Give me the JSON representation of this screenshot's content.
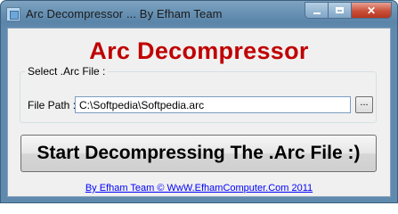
{
  "window": {
    "title": "Arc Decompressor ... By Efham Team",
    "controls": {
      "minimize": "minimize",
      "maximize": "maximize",
      "close": "✕"
    }
  },
  "main": {
    "heading": "Arc Decompressor",
    "group": {
      "label": "Select .Arc File :",
      "file_path_label": "File Path :",
      "file_path_value": "C:\\Softpedia\\Softpedia.arc",
      "browse_label": "..."
    },
    "start_button_label": "Start Decompressing The .Arc File :)",
    "footer_link": "By Efham Team © WwW.EfhamComputer.Com 2011"
  },
  "colors": {
    "heading": "#c00000",
    "link": "#0000ff"
  },
  "icons": {
    "app": "app-window-icon",
    "minimize": "minimize-icon",
    "maximize": "maximize-icon",
    "close": "close-icon"
  }
}
